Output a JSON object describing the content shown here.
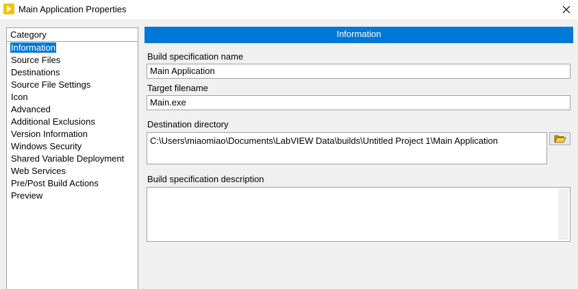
{
  "window": {
    "title": "Main Application Properties",
    "app_icon": "labview-play-icon",
    "close_icon": "close-icon"
  },
  "category": {
    "header": "Category",
    "selected_index": 0,
    "items": [
      {
        "label": "Information"
      },
      {
        "label": "Source Files"
      },
      {
        "label": "Destinations"
      },
      {
        "label": "Source File Settings"
      },
      {
        "label": "Icon"
      },
      {
        "label": "Advanced"
      },
      {
        "label": "Additional Exclusions"
      },
      {
        "label": "Version Information"
      },
      {
        "label": "Windows Security"
      },
      {
        "label": "Shared Variable Deployment"
      },
      {
        "label": "Web Services"
      },
      {
        "label": "Pre/Post Build Actions"
      },
      {
        "label": "Preview"
      }
    ]
  },
  "panel": {
    "header": "Information",
    "build_spec_name_label": "Build specification name",
    "build_spec_name_value": "Main Application",
    "target_filename_label": "Target filename",
    "target_filename_value": "Main.exe",
    "destination_directory_label": "Destination directory",
    "destination_directory_value": "C:\\Users\\miaomiao\\Documents\\LabVIEW Data\\builds\\Untitled Project 1\\Main Application",
    "browse_icon": "folder-open-icon",
    "description_label": "Build specification description",
    "description_value": ""
  },
  "colors": {
    "accent": "#0078d7",
    "icon_yellow": "#f5c400"
  }
}
